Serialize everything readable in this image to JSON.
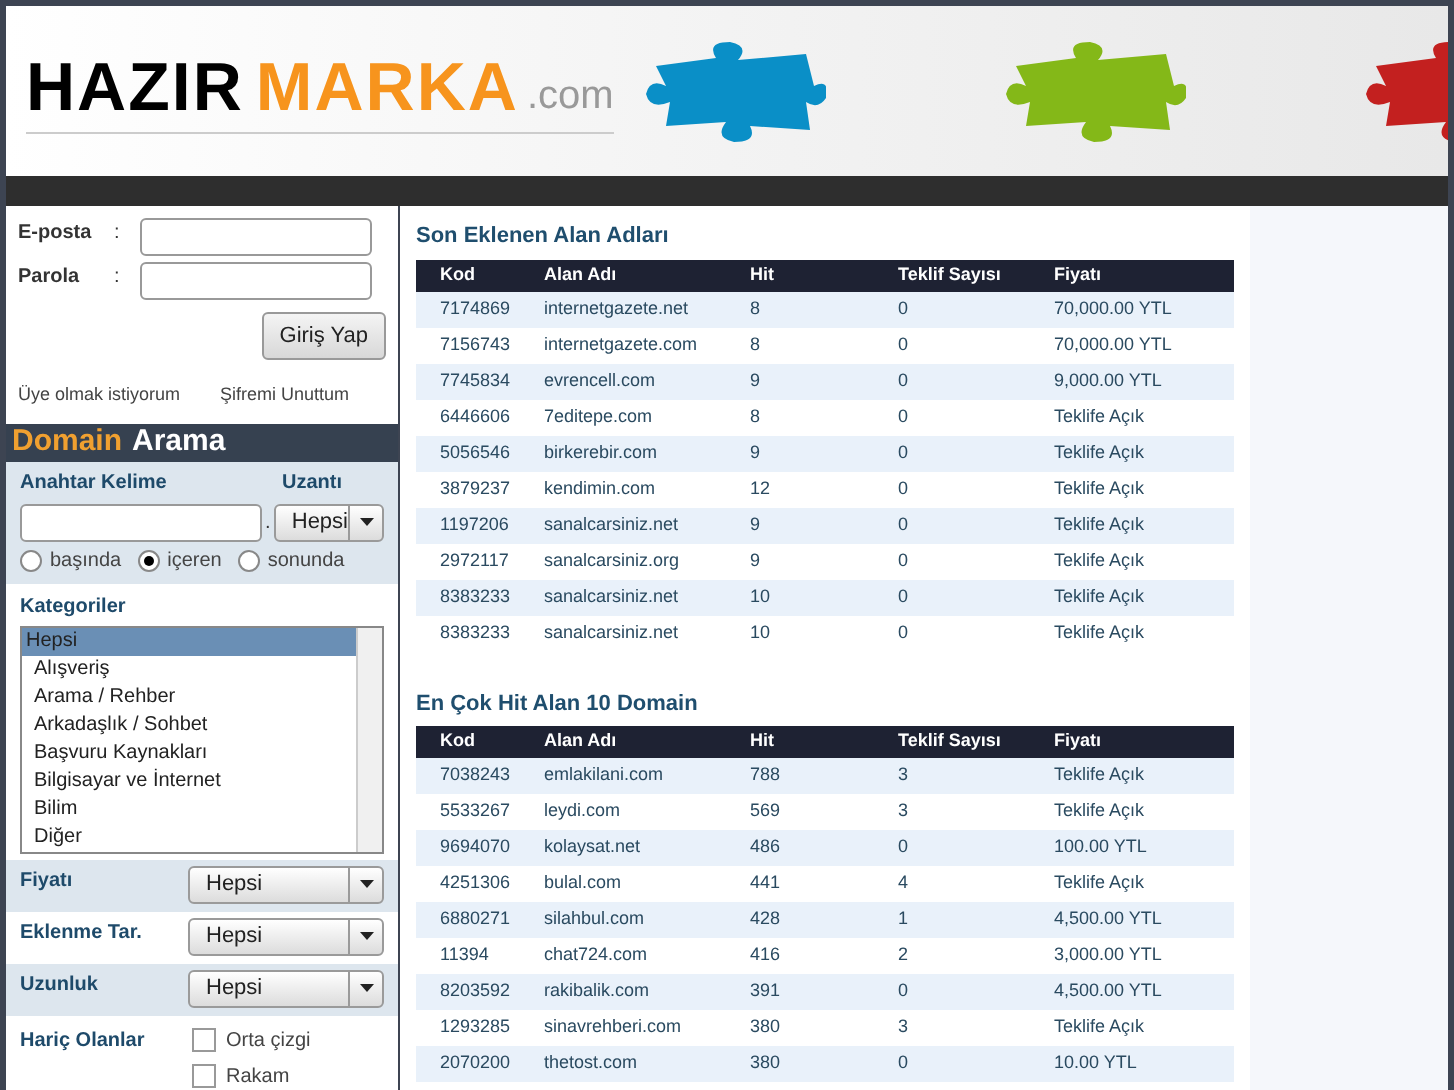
{
  "logo": {
    "part_1": "HAZIR",
    "part_2": "MARKA",
    "part_3": ".com"
  },
  "login": {
    "email_label": "E-posta",
    "password_label": "Parola",
    "colon": ":",
    "submit": "Giriş Yap",
    "links": [
      "Üye olmak istiyorum",
      "Şifremi Unuttum"
    ]
  },
  "search": {
    "title_1": "Domain",
    "title_2": "Arama",
    "keyword_label": "Anahtar Kelime",
    "extension_label": "Uzantı",
    "dot": ".",
    "extension_value": "Hepsi",
    "match_options": [
      {
        "label": "başında",
        "selected": false
      },
      {
        "label": "içeren",
        "selected": true
      },
      {
        "label": "sonunda",
        "selected": false
      }
    ],
    "categories_label": "Kategoriler",
    "categories": [
      {
        "label": "Hepsi",
        "selected": true
      },
      {
        "label": "Alışveriş",
        "selected": false
      },
      {
        "label": "Arama / Rehber",
        "selected": false
      },
      {
        "label": "Arkadaşlık / Sohbet",
        "selected": false
      },
      {
        "label": "Başvuru Kaynakları",
        "selected": false
      },
      {
        "label": "Bilgisayar ve İnternet",
        "selected": false
      },
      {
        "label": "Bilim",
        "selected": false
      },
      {
        "label": "Diğer",
        "selected": false
      }
    ],
    "filters": [
      {
        "label": "Fiyatı",
        "value": "Hepsi"
      },
      {
        "label": "Eklenme Tar.",
        "value": "Hepsi"
      },
      {
        "label": "Uzunluk",
        "value": "Hepsi"
      }
    ],
    "exclude_label": "Hariç Olanlar",
    "exclude_options": [
      {
        "label": "Orta çizgi",
        "checked": false
      },
      {
        "label": "Rakam",
        "checked": false
      }
    ]
  },
  "tables": [
    {
      "title": "Son Eklenen Alan Adları",
      "columns": [
        "Kod",
        "Alan Adı",
        "Hit",
        "Teklif Sayısı",
        "Fiyatı"
      ],
      "rows": [
        [
          "7174869",
          "internetgazete.net",
          "8",
          "0",
          "70,000.00 YTL"
        ],
        [
          "7156743",
          "internetgazete.com",
          "8",
          "0",
          "70,000.00 YTL"
        ],
        [
          "7745834",
          "evrencell.com",
          "9",
          "0",
          "9,000.00 YTL"
        ],
        [
          "6446606",
          "7editepe.com",
          "8",
          "0",
          "Teklife Açık"
        ],
        [
          "5056546",
          "birkerebir.com",
          "9",
          "0",
          "Teklife Açık"
        ],
        [
          "3879237",
          "kendimin.com",
          "12",
          "0",
          "Teklife Açık"
        ],
        [
          "1197206",
          "sanalcarsiniz.net",
          "9",
          "0",
          "Teklife Açık"
        ],
        [
          "2972117",
          "sanalcarsiniz.org",
          "9",
          "0",
          "Teklife Açık"
        ],
        [
          "8383233",
          "sanalcarsiniz.net",
          "10",
          "0",
          "Teklife Açık"
        ],
        [
          "8383233",
          "sanalcarsiniz.net",
          "10",
          "0",
          "Teklife Açık"
        ]
      ]
    },
    {
      "title": "En Çok Hit Alan 10 Domain",
      "columns": [
        "Kod",
        "Alan Adı",
        "Hit",
        "Teklif Sayısı",
        "Fiyatı"
      ],
      "rows": [
        [
          "7038243",
          "emlakilani.com",
          "788",
          "3",
          "Teklife Açık"
        ],
        [
          "5533267",
          "leydi.com",
          "569",
          "3",
          "Teklife Açık"
        ],
        [
          "9694070",
          "kolaysat.net",
          "486",
          "0",
          "100.00 YTL"
        ],
        [
          "4251306",
          "bulal.com",
          "441",
          "4",
          "Teklife Açık"
        ],
        [
          "6880271",
          "silahbul.com",
          "428",
          "1",
          "4,500.00 YTL"
        ],
        [
          "11394",
          "chat724.com",
          "416",
          "2",
          "3,000.00 YTL"
        ],
        [
          "8203592",
          "rakibalik.com",
          "391",
          "0",
          "4,500.00 YTL"
        ],
        [
          "1293285",
          "sinavrehberi.com",
          "380",
          "3",
          "Teklife Açık"
        ],
        [
          "2070200",
          "thetost.com",
          "380",
          "0",
          "10.00 YTL"
        ]
      ]
    }
  ]
}
